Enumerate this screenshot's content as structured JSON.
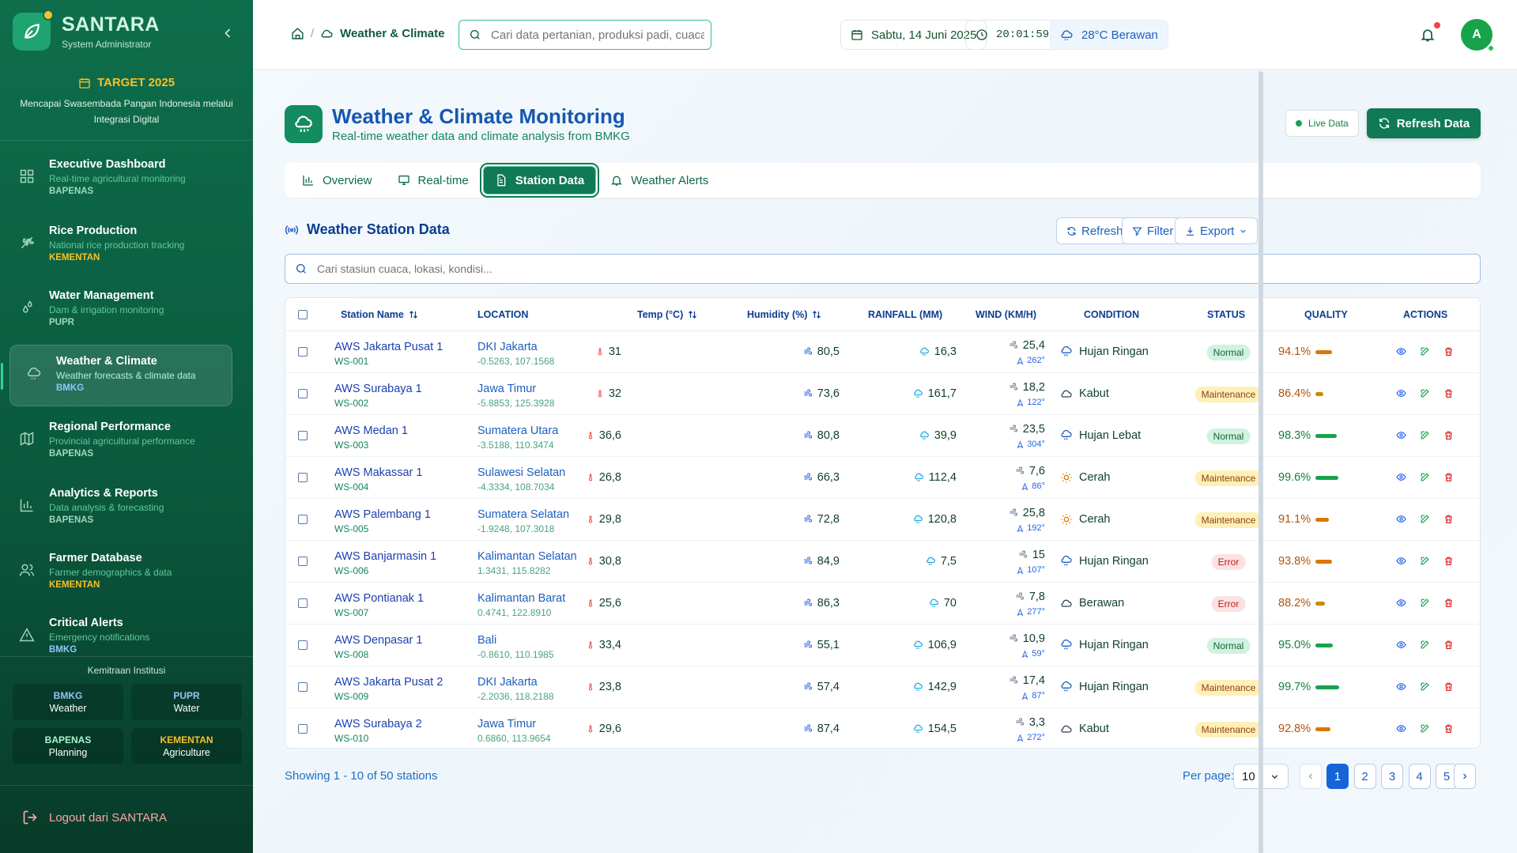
{
  "brand": {
    "name": "SANTARA",
    "role": "System Administrator"
  },
  "target": {
    "title": "TARGET 2025",
    "desc": "Mencapai Swasembada Pangan Indonesia melalui Integrasi Digital"
  },
  "nav": [
    {
      "title": "Executive Dashboard",
      "sub": "Real-time agricultural monitoring",
      "agency": "BAPENAS",
      "icon": "dashboard-icon"
    },
    {
      "title": "Rice Production",
      "sub": "National rice production tracking",
      "agency": "KEMENTAN",
      "icon": "wheat-icon"
    },
    {
      "title": "Water Management",
      "sub": "Dam & irrigation monitoring",
      "agency": "PUPR",
      "icon": "droplets-icon"
    },
    {
      "title": "Weather & Climate",
      "sub": "Weather forecasts & climate data",
      "agency": "BMKG",
      "icon": "cloud-icon"
    },
    {
      "title": "Regional Performance",
      "sub": "Provincial agricultural performance",
      "agency": "BAPENAS",
      "icon": "map-icon"
    },
    {
      "title": "Analytics & Reports",
      "sub": "Data analysis & forecasting",
      "agency": "BAPENAS",
      "icon": "bar-chart-icon"
    },
    {
      "title": "Farmer Database",
      "sub": "Farmer demographics & data",
      "agency": "KEMENTAN",
      "icon": "users-icon"
    },
    {
      "title": "Critical Alerts",
      "sub": "Emergency notifications",
      "agency": "BMKG",
      "icon": "alert-triangle-icon"
    }
  ],
  "partners": {
    "title": "Kemitraan Institusi",
    "items": [
      {
        "a": "BMKG",
        "b": "Weather",
        "color": "#93c5fd"
      },
      {
        "a": "PUPR",
        "b": "Water",
        "color": "#93c5fd"
      },
      {
        "a": "BAPENAS",
        "b": "Planning",
        "color": "#a7f3d0"
      },
      {
        "a": "KEMENTAN",
        "b": "Agriculture",
        "color": "#fbbf24"
      }
    ]
  },
  "logout": "Logout dari SANTARA",
  "header": {
    "breadcrumb": "Weather & Climate",
    "search_placeholder": "Cari data pertanian, produksi padi, cuaca",
    "date": "Sabtu, 14 Juni 2025",
    "time": "20:01:59",
    "weather": "28°C Berawan",
    "avatar": "A"
  },
  "page": {
    "title": "Weather & Climate Monitoring",
    "subtitle": "Real-time weather data and climate analysis from BMKG",
    "live": "Live Data",
    "refresh": "Refresh Data"
  },
  "tabs": [
    "Overview",
    "Real-time",
    "Station Data",
    "Weather Alerts"
  ],
  "section": {
    "title": "Weather Station Data",
    "refresh": "Refresh",
    "filter": "Filter",
    "export": "Export",
    "search_placeholder": "Cari stasiun cuaca, lokasi, kondisi..."
  },
  "columns": [
    "Station Name",
    "LOCATION",
    "Temp (°C)",
    "Humidity (%)",
    "RAINFALL (MM)",
    "WIND (KM/H)",
    "CONDITION",
    "STATUS",
    "QUALITY",
    "ACTIONS"
  ],
  "rows": [
    {
      "name": "AWS Jakarta Pusat 1",
      "id": "WS-001",
      "loc": "DKI Jakarta",
      "coord": "-0.5263, 107.1568",
      "temp": "31",
      "hum": "80,5",
      "rain": "16,3",
      "wind": "25,4",
      "dir": "262°",
      "cond": "Hujan Ringan",
      "cicon": "rain",
      "status": "Normal",
      "quality": "94.1%",
      "q": 0.941
    },
    {
      "name": "AWS Surabaya 1",
      "id": "WS-002",
      "loc": "Jawa Timur",
      "coord": "-5.8853, 125.3928",
      "temp": "32",
      "hum": "73,6",
      "rain": "161,7",
      "wind": "18,2",
      "dir": "122°",
      "cond": "Kabut",
      "cicon": "cloud",
      "status": "Maintenance",
      "quality": "86.4%",
      "q": 0.864
    },
    {
      "name": "AWS Medan 1",
      "id": "WS-003",
      "loc": "Sumatera Utara",
      "coord": "-3.5188, 110.3474",
      "temp": "36,6",
      "hum": "80,8",
      "rain": "39,9",
      "wind": "23,5",
      "dir": "304°",
      "cond": "Hujan Lebat",
      "cicon": "rain",
      "status": "Normal",
      "quality": "98.3%",
      "q": 0.983
    },
    {
      "name": "AWS Makassar 1",
      "id": "WS-004",
      "loc": "Sulawesi Selatan",
      "coord": "-4.3334, 108.7034",
      "temp": "26,8",
      "hum": "66,3",
      "rain": "112,4",
      "wind": "7,6",
      "dir": "86°",
      "cond": "Cerah",
      "cicon": "sun",
      "status": "Maintenance",
      "quality": "99.6%",
      "q": 0.996
    },
    {
      "name": "AWS Palembang 1",
      "id": "WS-005",
      "loc": "Sumatera Selatan",
      "coord": "-1.9248, 107.3018",
      "temp": "29,8",
      "hum": "72,8",
      "rain": "120,8",
      "wind": "25,8",
      "dir": "192°",
      "cond": "Cerah",
      "cicon": "sun",
      "status": "Maintenance",
      "quality": "91.1%",
      "q": 0.911
    },
    {
      "name": "AWS Banjarmasin 1",
      "id": "WS-006",
      "loc": "Kalimantan Selatan",
      "coord": "1.3431, 115.8282",
      "temp": "30,8",
      "hum": "84,9",
      "rain": "7,5",
      "wind": "15",
      "dir": "107°",
      "cond": "Hujan Ringan",
      "cicon": "rain",
      "status": "Error",
      "quality": "93.8%",
      "q": 0.938
    },
    {
      "name": "AWS Pontianak 1",
      "id": "WS-007",
      "loc": "Kalimantan Barat",
      "coord": "0.4741, 122.8910",
      "temp": "25,6",
      "hum": "86,3",
      "rain": "70",
      "wind": "7,8",
      "dir": "277°",
      "cond": "Berawan",
      "cicon": "cloud",
      "status": "Error",
      "quality": "88.2%",
      "q": 0.882
    },
    {
      "name": "AWS Denpasar 1",
      "id": "WS-008",
      "loc": "Bali",
      "coord": "-0.8610, 110.1985",
      "temp": "33,4",
      "hum": "55,1",
      "rain": "106,9",
      "wind": "10,9",
      "dir": "59°",
      "cond": "Hujan Ringan",
      "cicon": "rain",
      "status": "Normal",
      "quality": "95.0%",
      "q": 0.95
    },
    {
      "name": "AWS Jakarta Pusat 2",
      "id": "WS-009",
      "loc": "DKI Jakarta",
      "coord": "-2.2036, 118.2188",
      "temp": "23,8",
      "hum": "57,4",
      "rain": "142,9",
      "wind": "17,4",
      "dir": "87°",
      "cond": "Hujan Ringan",
      "cicon": "rain",
      "status": "Maintenance",
      "quality": "99.7%",
      "q": 0.997
    },
    {
      "name": "AWS Surabaya 2",
      "id": "WS-010",
      "loc": "Jawa Timur",
      "coord": "0.6860, 113.9654",
      "temp": "29,6",
      "hum": "87,4",
      "rain": "154,5",
      "wind": "3,3",
      "dir": "272°",
      "cond": "Kabut",
      "cicon": "cloud",
      "status": "Maintenance",
      "quality": "92.8%",
      "q": 0.928
    }
  ],
  "footer": {
    "showing": "Showing 1 - 10 of 50 stations",
    "per_page_label": "Per page:",
    "per_page": "10",
    "pages": [
      "1",
      "2",
      "3",
      "4",
      "5"
    ]
  }
}
